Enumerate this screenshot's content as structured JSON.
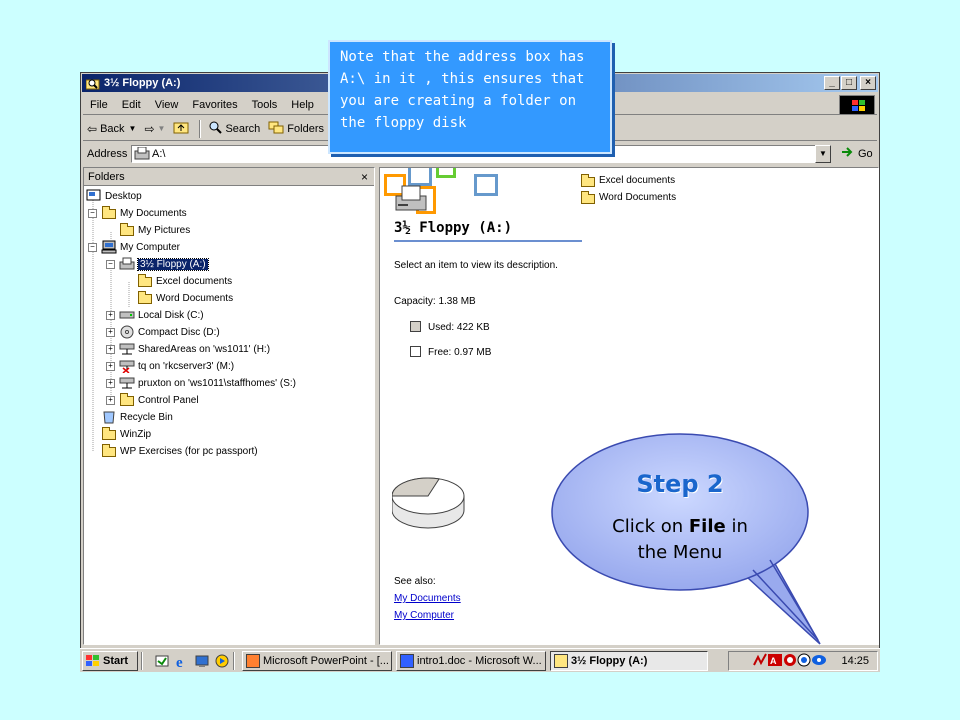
{
  "window": {
    "title": "3½ Floppy (A:)",
    "controls": {
      "minimize": "_",
      "maximize": "□",
      "close": "×"
    }
  },
  "menu": [
    "File",
    "Edit",
    "View",
    "Favorites",
    "Tools",
    "Help"
  ],
  "toolbar": {
    "back": "Back",
    "search": "Search",
    "folders": "Folders"
  },
  "address": {
    "label": "Address",
    "value": "A:\\",
    "go": "Go"
  },
  "folders_pane": {
    "title": "Folders",
    "close": "×",
    "items": [
      {
        "label": "Desktop",
        "exp": ""
      },
      {
        "label": "My Documents",
        "exp": "−"
      },
      {
        "label": "My Pictures",
        "exp": ""
      },
      {
        "label": "My Computer",
        "exp": "−"
      },
      {
        "label": "3½ Floppy (A:)",
        "exp": "−"
      },
      {
        "label": "Excel documents",
        "exp": ""
      },
      {
        "label": "Word Documents",
        "exp": ""
      },
      {
        "label": "Local Disk (C:)",
        "exp": "+"
      },
      {
        "label": "Compact Disc (D:)",
        "exp": "+"
      },
      {
        "label": "SharedAreas on 'ws1011' (H:)",
        "exp": "+"
      },
      {
        "label": "tq on 'rkcserver3' (M:)",
        "exp": "+"
      },
      {
        "label": "pruxton on 'ws1011\\staffhomes' (S:)",
        "exp": "+"
      },
      {
        "label": "Control Panel",
        "exp": "+"
      },
      {
        "label": "Recycle Bin",
        "exp": ""
      },
      {
        "label": "WinZip",
        "exp": ""
      },
      {
        "label": "WP Exercises (for pc passport)",
        "exp": ""
      }
    ]
  },
  "content": {
    "heading": "3½ Floppy (A:)",
    "prompt": "Select an item to view its description.",
    "capacity": "Capacity: 1.38 MB",
    "used": "Used: 422 KB",
    "free": "Free: 0.97 MB",
    "used_fraction": 0.3,
    "see_also": "See also:",
    "links": [
      "My Documents",
      "My Computer"
    ],
    "files": [
      "Excel documents",
      "Word Documents"
    ],
    "colors": {
      "used": "#d4d0c8",
      "free": "#ffffff"
    }
  },
  "taskbar": {
    "start": "Start",
    "tasks": [
      "Microsoft PowerPoint - [...",
      "intro1.doc - Microsoft W...",
      "3½ Floppy (A:)"
    ],
    "clock": "14:25"
  },
  "callout": {
    "note": "Note that the address box has A:\\ in it , this ensures that you are creating a folder on the floppy disk",
    "step_title": "Step 2",
    "step_line1_pre": "Click on ",
    "step_line1_bold": "File",
    "step_line1_post": " in",
    "step_line2": "the Menu"
  }
}
